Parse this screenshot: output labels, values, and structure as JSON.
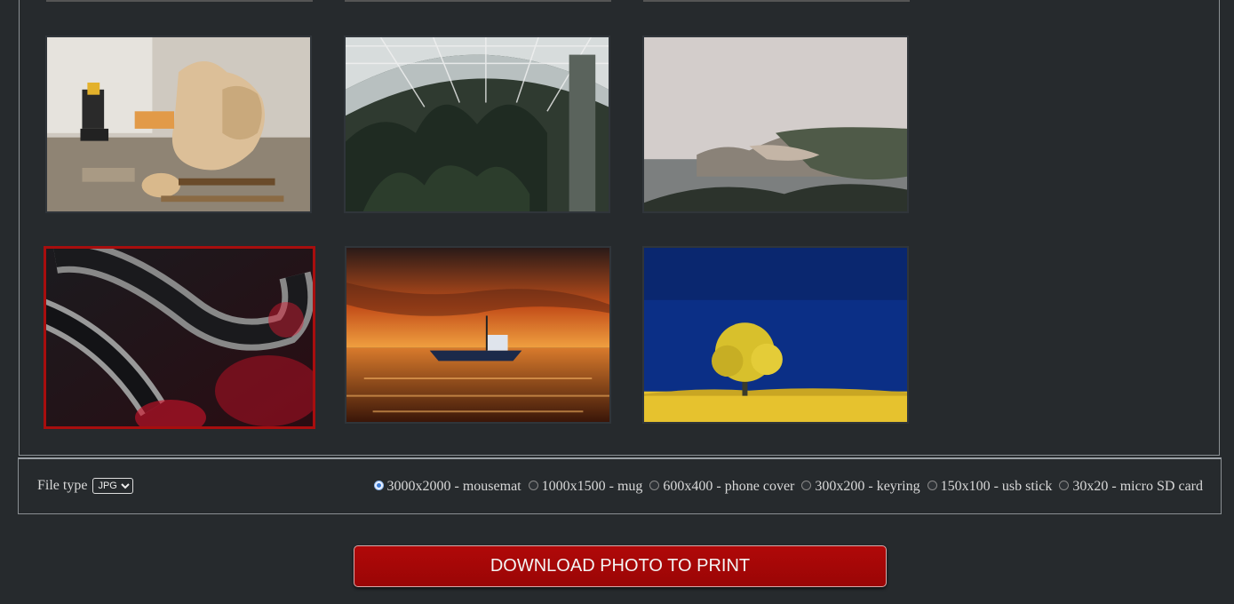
{
  "gallery": {
    "photos": [
      {
        "subject": "woodworking workbench with drill and chisels",
        "selected": false
      },
      {
        "subject": "glasshouse with tropical plants",
        "selected": false
      },
      {
        "subject": "foggy coastal cliffs",
        "selected": false
      },
      {
        "subject": "abstract chrome and red curves",
        "selected": true
      },
      {
        "subject": "boat at orange sunset",
        "selected": false
      },
      {
        "subject": "yellow tree under blue sky",
        "selected": false
      }
    ]
  },
  "options": {
    "file_type_label": "File type",
    "file_type_value": "JPG",
    "sizes": [
      {
        "label": "3000x2000 - mousemat",
        "checked": true
      },
      {
        "label": "1000x1500 - mug",
        "checked": false
      },
      {
        "label": "600x400 - phone cover",
        "checked": false
      },
      {
        "label": "300x200 - keyring",
        "checked": false
      },
      {
        "label": "150x100 - usb stick",
        "checked": false
      },
      {
        "label": "30x20 - micro SD card",
        "checked": false
      }
    ]
  },
  "download_label": "DOWNLOAD PHOTO TO PRINT",
  "colors": {
    "accent": "#a80e0e",
    "background": "#262a2d"
  }
}
